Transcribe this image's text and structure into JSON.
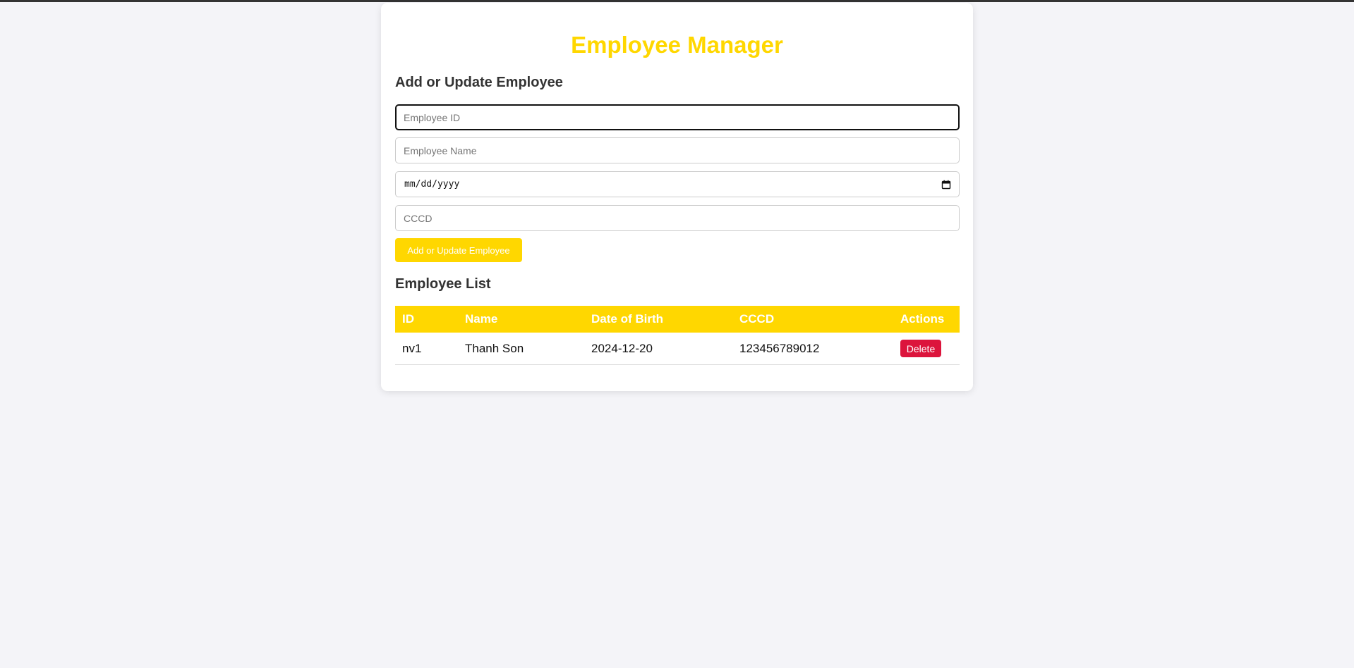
{
  "app": {
    "title": "Employee Manager",
    "accent_color": "#ffd700",
    "danger_color": "#dc143c"
  },
  "form": {
    "heading": "Add or Update Employee",
    "fields": {
      "employee_id": {
        "placeholder": "Employee ID",
        "value": ""
      },
      "employee_name": {
        "placeholder": "Employee Name",
        "value": ""
      },
      "date_of_birth": {
        "placeholder": "mm/dd/yyyy",
        "value": "",
        "icon": "calendar-icon"
      },
      "cccd": {
        "placeholder": "CCCD",
        "value": ""
      }
    },
    "submit_label": "Add or Update Employee"
  },
  "list": {
    "heading": "Employee List",
    "columns": [
      "ID",
      "Name",
      "Date of Birth",
      "CCCD",
      "Actions"
    ],
    "rows": [
      {
        "id": "nv1",
        "name": "Thanh Son",
        "date_of_birth": "2024-12-20",
        "cccd": "123456789012",
        "action_label": "Delete"
      }
    ]
  }
}
